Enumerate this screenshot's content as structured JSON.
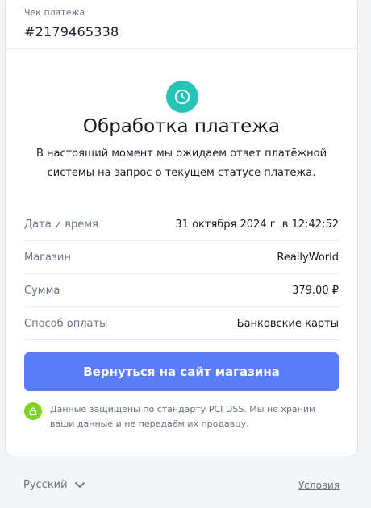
{
  "receipt": {
    "label": "Чек платежа",
    "number": "#2179465338"
  },
  "status": {
    "icon": "clock-icon",
    "title": "Обработка платежа",
    "message": "В настоящий момент мы ожидаем ответ платёжной системы на запрос о текущем статусе платежа."
  },
  "details": [
    {
      "key": "Дата и время",
      "value": "31 октября 2024 г. в 12:42:52"
    },
    {
      "key": "Магазин",
      "value": "ReallyWorld"
    },
    {
      "key": "Сумма",
      "value": "379.00 ₽"
    },
    {
      "key": "Способ оплаты",
      "value": "Банковские карты"
    }
  ],
  "back_button": {
    "label": "Вернуться на сайт магазина"
  },
  "security": {
    "icon": "lock-icon",
    "text": "Данные защищены по стандарту PCI DSS. Мы не храним ваши данные и не передаём их продавцу."
  },
  "footer": {
    "language": "Русский",
    "terms": "Условия"
  },
  "colors": {
    "accent": "#5b7cf7",
    "status_icon": "#27c3b6",
    "security_icon": "#7ed321"
  }
}
